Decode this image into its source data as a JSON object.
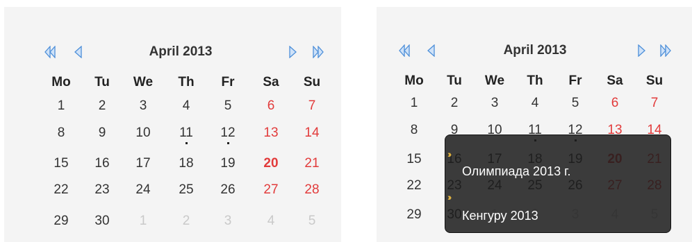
{
  "calendar_left": {
    "title": "April 2013",
    "nav": {
      "prev_year_icon": "double-chevron-left-icon",
      "prev_month_icon": "chevron-left-icon",
      "next_month_icon": "chevron-right-icon",
      "next_year_icon": "double-chevron-right-icon"
    },
    "weekdays": [
      "Mo",
      "Tu",
      "We",
      "Th",
      "Fr",
      "Sa",
      "Su"
    ],
    "weeks": [
      [
        "1",
        "2",
        "3",
        "4",
        "5",
        "6",
        "7"
      ],
      [
        "8",
        "9",
        "10",
        "11",
        "12",
        "13",
        "14"
      ],
      [
        "15",
        "16",
        "17",
        "18",
        "19",
        "20",
        "21"
      ],
      [
        "22",
        "23",
        "24",
        "25",
        "26",
        "27",
        "28"
      ],
      [
        "29",
        "30",
        "1",
        "2",
        "3",
        "4",
        "5"
      ]
    ]
  },
  "calendar_right": {
    "title": "April 2013",
    "weekdays": [
      "Mo",
      "Tu",
      "We",
      "Th",
      "Fr",
      "Sa",
      "Su"
    ],
    "weeks": [
      [
        "1",
        "2",
        "3",
        "4",
        "5",
        "6",
        "7"
      ],
      [
        "8",
        "9",
        "10",
        "11",
        "12",
        "13",
        "14"
      ],
      [
        "15",
        "16",
        "17",
        "18",
        "19",
        "20",
        "21"
      ],
      [
        "22",
        "23",
        "24",
        "25",
        "26",
        "27",
        "28"
      ],
      [
        "29",
        "30",
        "1",
        "2",
        "3",
        "4",
        "5"
      ]
    ]
  },
  "tooltip": {
    "arrow_icon": "double-chevron-right-icon",
    "events": [
      "Олимпиада 2013 г.",
      "Кенгуру 2013"
    ]
  },
  "colors": {
    "panel_bg": "#f4f4f4",
    "weekend": "#e23b3b",
    "other_month": "#c9c9c9",
    "nav_icon": "#5b9be0",
    "tooltip_bg": "#1c1c1c",
    "tooltip_arrow": "#e0b341"
  }
}
